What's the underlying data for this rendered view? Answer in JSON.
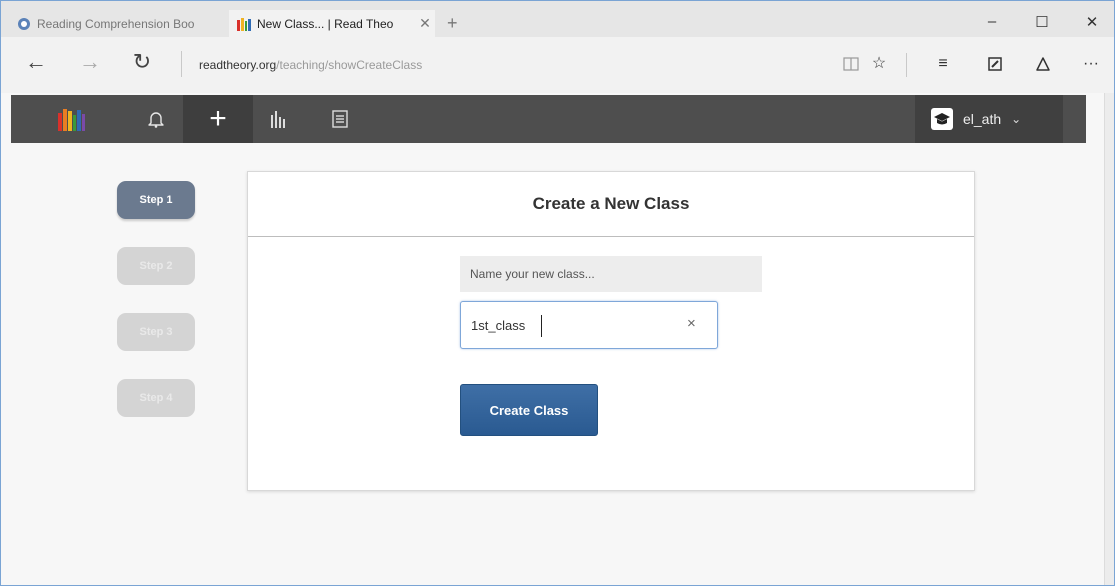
{
  "browser": {
    "tabs": [
      {
        "label": "Reading Comprehension Boo"
      },
      {
        "label": "New Class... | Read Theo",
        "close": "✕"
      }
    ],
    "new_tab": "+",
    "window_controls": {
      "minimize": "–",
      "maximize": "☐",
      "close": "✕"
    },
    "nav": {
      "back": "←",
      "forward": "→",
      "reload": "↻"
    },
    "address": {
      "domain": "readtheory.org",
      "path": "/teaching/showCreateClass"
    },
    "toolbar_icons": [
      "reading-view-icon",
      "favorite-star-icon",
      "hub-icon",
      "web-note-icon",
      "share-icon",
      "more-icon"
    ],
    "more": "···"
  },
  "site_nav": {
    "plus": "+",
    "user": {
      "name": "el_ath",
      "chevron": "⌄"
    }
  },
  "steps": [
    {
      "label": "Step 1",
      "state": "active"
    },
    {
      "label": "Step 2",
      "state": "inactive"
    },
    {
      "label": "Step 3",
      "state": "inactive"
    },
    {
      "label": "Step 4",
      "state": "inactive"
    }
  ],
  "card": {
    "title": "Create a New Class",
    "prompt": "Name your new class...",
    "class_name_value": "1st_class",
    "clear": "×",
    "submit_label": "Create Class"
  },
  "colors": {
    "accent": "#2f5f96",
    "nav_bar": "#4e4e4e",
    "step_active": "#6b7a8f",
    "step_inactive": "#d4d4d4"
  }
}
